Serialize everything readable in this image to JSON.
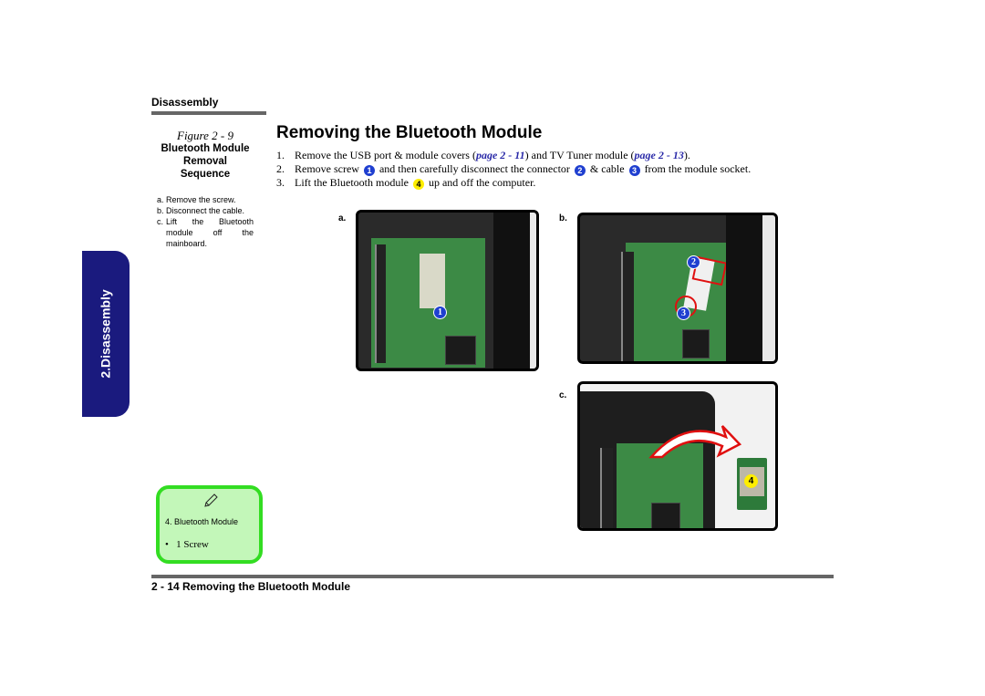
{
  "header": {
    "section_label": "Disassembly"
  },
  "side_tab": {
    "label": "2.Disassembly",
    "color": "#1a1a7e"
  },
  "figure": {
    "number": "Figure 2 - 9",
    "title_lines": [
      "Bluetooth Module",
      "Removal",
      "Sequence"
    ],
    "steps": [
      {
        "letter": "a.",
        "text": "Remove the screw."
      },
      {
        "letter": "b.",
        "text": "Disconnect the cable."
      },
      {
        "letter": "c.",
        "text": "Lift the Bluetooth module off the mainboard."
      }
    ]
  },
  "main": {
    "title": "Removing the Bluetooth Module",
    "steps": [
      {
        "num": "1.",
        "parts": [
          "Remove the USB port & module covers (",
          "page 2 - 11",
          ") and TV Tuner module (",
          "page 2 - 13",
          ")."
        ]
      },
      {
        "num": "2.",
        "parts": [
          "Remove screw ",
          "1",
          " and then carefully disconnect the connector ",
          "2",
          " & cable ",
          "3",
          " from the module socket."
        ]
      },
      {
        "num": "3.",
        "parts": [
          "Lift the Bluetooth module ",
          "4",
          " up and off the computer."
        ]
      }
    ],
    "link_color": "#2a2aa8"
  },
  "photos": [
    {
      "label": "a.",
      "callouts": [
        "1"
      ],
      "description": "Bluetooth module on mainboard with screw"
    },
    {
      "label": "b.",
      "callouts": [
        "2",
        "3"
      ],
      "description": "Connector and cable highlighted"
    },
    {
      "label": "c.",
      "callouts": [
        "4"
      ],
      "description": "Bluetooth module lifted off"
    }
  ],
  "note": {
    "icon": "pencil-icon",
    "heading": "4. Bluetooth Module",
    "bullet": "1 Screw",
    "bg_color": "#c3f7b9",
    "border_color": "#33dd22"
  },
  "footer": {
    "label": "2  -  14  Removing the Bluetooth Module"
  }
}
